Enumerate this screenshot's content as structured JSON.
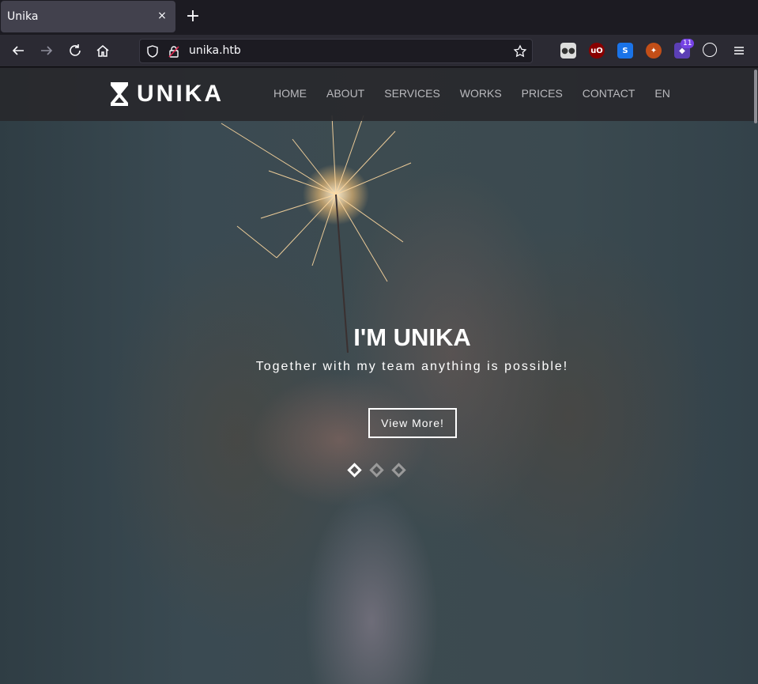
{
  "browser": {
    "tab_title": "Unika",
    "tab_close": "×",
    "new_tab": "+",
    "url": "unika.htb",
    "extension_badge": "11"
  },
  "site": {
    "logo_text": "UNIKA",
    "menu": [
      "HOME",
      "ABOUT",
      "SERVICES",
      "WORKS",
      "PRICES",
      "CONTACT",
      "EN"
    ],
    "hero": {
      "title": "I'M UNIKA",
      "subtitle": "Together with my team anything is possible!",
      "button": "View More!",
      "slides": 3,
      "active_slide": 1
    }
  },
  "colors": {
    "tab_active": "#42414d",
    "navbar": "#2b2a33",
    "header": "#28282c",
    "menu_text": "#b9b9bd"
  },
  "icons": [
    "back-icon",
    "forward-icon",
    "reload-icon",
    "home-icon",
    "shield-icon",
    "lock-icon",
    "star-icon",
    "menu-icon"
  ]
}
